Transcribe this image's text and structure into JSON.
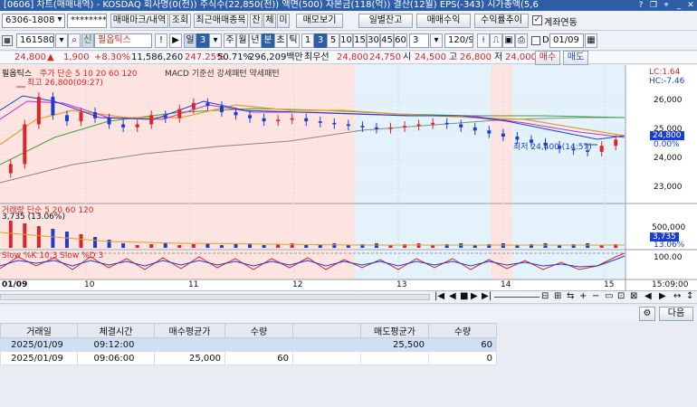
{
  "window": {
    "title": "[0606] 차트(매매내역) - KOSDAQ 회사명(0(전)) 주식수(22,850(천)) 액면(500) 자본금(118(억)) 결산(12월) EPS(-343) 시가총액(5,6",
    "icons": [
      "question-icon",
      "restore-icon",
      "pin-icon",
      "minimize-icon",
      "close-icon"
    ]
  },
  "toolbar1": {
    "code": "6306-1808",
    "password": "********",
    "buttons": [
      "매매마크/내역",
      "조회",
      "최근매매종목",
      "잔",
      "체",
      "미",
      "매모보기",
      "일별잔고",
      "매매수익",
      "수익률추이"
    ],
    "account_check": "계좌연동"
  },
  "toolbar2": {
    "stock_code": "161580",
    "stock_name": "필옵틱스",
    "period_label": "일",
    "period_num": "3",
    "periods": [
      "주",
      "월",
      "년",
      "분",
      "초",
      "틱"
    ],
    "minutes": [
      "1",
      "3",
      "5",
      "10",
      "15",
      "30",
      "45",
      "60"
    ],
    "count": "3",
    "range": "120/900",
    "date_field": "01/09"
  },
  "price": {
    "current": "24,800",
    "change": "1,900",
    "change_pct": "+8.30%",
    "volume": "11,586,260",
    "turnover": "247.25%",
    "ratio": "50.71%",
    "amount": "296,209백만",
    "bid_label": "최우선",
    "bid1": "24,800",
    "bid2": "24,750",
    "open_label": "시",
    "open": "24,500",
    "high_label": "고",
    "high": "26,800",
    "low_label": "저",
    "low": "24,000",
    "buy_btn": "매수",
    "sell_btn": "매도"
  },
  "chart": {
    "legend_main": "필옵틱스",
    "legend_ma": "주가 단순 5 10 20 60 120",
    "legend_macd": "MACD 기준선 강세패턴 약세패턴",
    "high_annot": "최고 26,800(09:27)",
    "low_annot": "최저 24,400 (14:57)",
    "lc": "LC:1.64",
    "hc": "HC:-7.46",
    "y_ticks": [
      "26,000",
      "25,000",
      "24,000",
      "23,000"
    ],
    "price_tag": "24,800",
    "pct_tag": "0.00%",
    "vol_legend": "거래량 단순 5 20 60 120",
    "vol_note": "3,735 (13.06%)",
    "vol_ticks": [
      "500,000"
    ],
    "vol_tag": "3,735",
    "vol_pct_tag": "13.06%",
    "stoch_legend": "Slow %K 10,3  Slow %D 3",
    "stoch_tick": "100.00",
    "x_labels": [
      "01/09",
      "10",
      "11",
      "12",
      "13",
      "14",
      "15"
    ],
    "time_label": "15:09:00"
  },
  "chart_data": {
    "type": "candlestick",
    "series": [
      {
        "name": "close",
        "values": [
          24000,
          25300,
          26200,
          25600,
          25400,
          25700,
          25500,
          25300,
          25200,
          25300,
          25600,
          25500,
          25800,
          26000,
          25900,
          25700,
          25600,
          25500,
          25400,
          25450,
          25500,
          25400,
          25350,
          25300,
          25250,
          25200,
          25150,
          25200,
          25250,
          25300,
          25350,
          25300,
          25200,
          25100,
          25000,
          24900,
          24800,
          24700,
          24600,
          24500,
          24450,
          24400,
          24600,
          24800
        ]
      }
    ],
    "ylim": [
      22800,
      27000
    ]
  },
  "bottom": {
    "next_btn": "다음",
    "headers": [
      "거래일",
      "체결시간",
      "매수평균가",
      "수량",
      "",
      "매도평균가",
      "수량"
    ],
    "rows": [
      {
        "date": "2025/01/09",
        "time": "09:12:00",
        "buy_avg": "",
        "buy_qty": "",
        "blank": "",
        "sell_avg": "25,500",
        "sell_qty": "60"
      },
      {
        "date": "2025/01/09",
        "time": "09:06:00",
        "buy_avg": "25,000",
        "buy_qty": "60",
        "blank": "",
        "sell_avg": "",
        "sell_qty": "0"
      }
    ]
  }
}
